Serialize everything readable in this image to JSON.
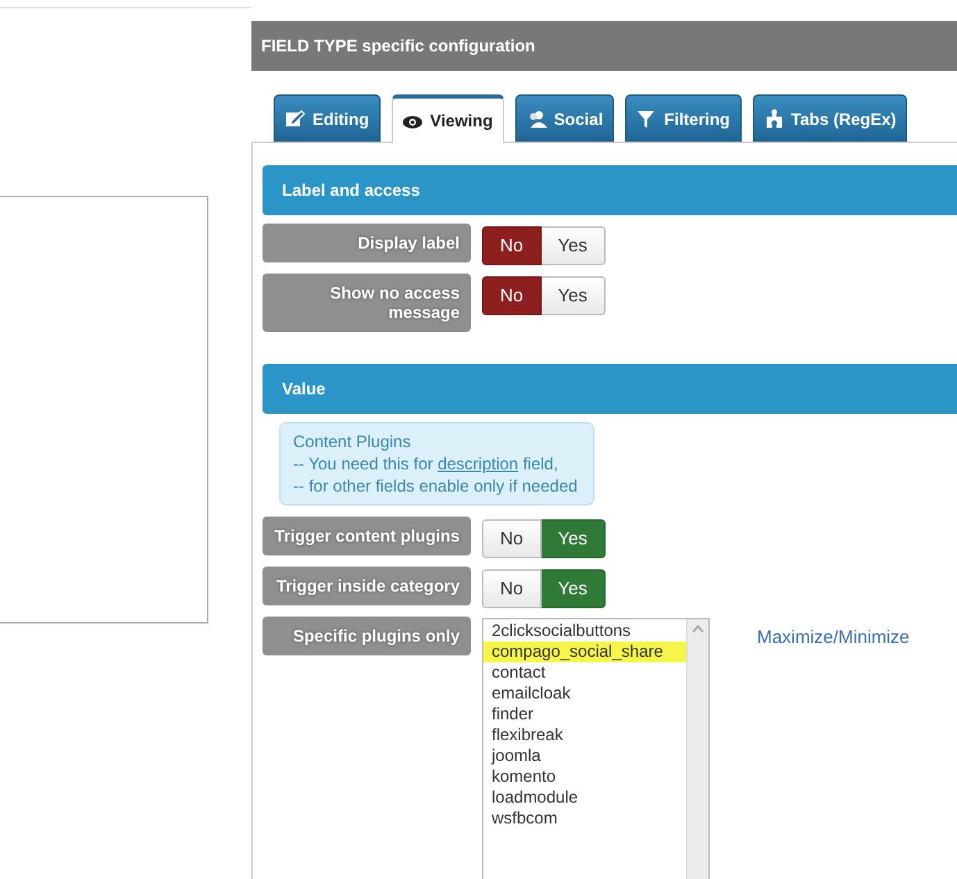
{
  "panel_title": "FIELD TYPE specific configuration",
  "tabs": [
    {
      "label": "Editing",
      "selected": false
    },
    {
      "label": "Viewing",
      "selected": true
    },
    {
      "label": "Social",
      "selected": false
    },
    {
      "label": "Filtering",
      "selected": false
    },
    {
      "label": "Tabs (RegEx)",
      "selected": false
    }
  ],
  "sections": [
    {
      "title": "Label and access",
      "rows": [
        {
          "kind": "toggle",
          "label": "Display label",
          "options": [
            {
              "label": "No",
              "selected": true
            },
            {
              "label": "Yes",
              "selected": false
            }
          ]
        },
        {
          "kind": "toggle",
          "label": "Show no access message",
          "options": [
            {
              "label": "No",
              "selected": true
            },
            {
              "label": "Yes",
              "selected": false
            }
          ]
        }
      ]
    },
    {
      "title": "Value",
      "rows": [
        {
          "kind": "note",
          "title": "Content Plugins",
          "lines": [
            {
              "before": "-- You need this for ",
              "link": "description",
              "after": " field,"
            },
            {
              "before": "-- for other fields enable only if needed"
            }
          ]
        },
        {
          "kind": "toggle",
          "label": "Trigger content plugins",
          "options": [
            {
              "label": "No",
              "selected": false
            },
            {
              "label": "Yes",
              "selected": true
            }
          ]
        },
        {
          "kind": "toggle",
          "label": "Trigger inside category",
          "options": [
            {
              "label": "No",
              "selected": false
            },
            {
              "label": "Yes",
              "selected": true
            }
          ]
        },
        {
          "kind": "list",
          "label": "Specific plugins only",
          "link": "Maximize/Minimize",
          "items": [
            {
              "label": "2clicksocialbuttons",
              "highlighted": false
            },
            {
              "label": "compago_social_share",
              "highlighted": true
            },
            {
              "label": "contact",
              "highlighted": false
            },
            {
              "label": "emailcloak",
              "highlighted": false
            },
            {
              "label": "finder",
              "highlighted": false
            },
            {
              "label": "flexibreak",
              "highlighted": false
            },
            {
              "label": "joomla",
              "highlighted": false
            },
            {
              "label": "komento",
              "highlighted": false
            },
            {
              "label": "loadmodule",
              "highlighted": false
            },
            {
              "label": "wsfbcom",
              "highlighted": false
            }
          ]
        }
      ]
    }
  ]
}
